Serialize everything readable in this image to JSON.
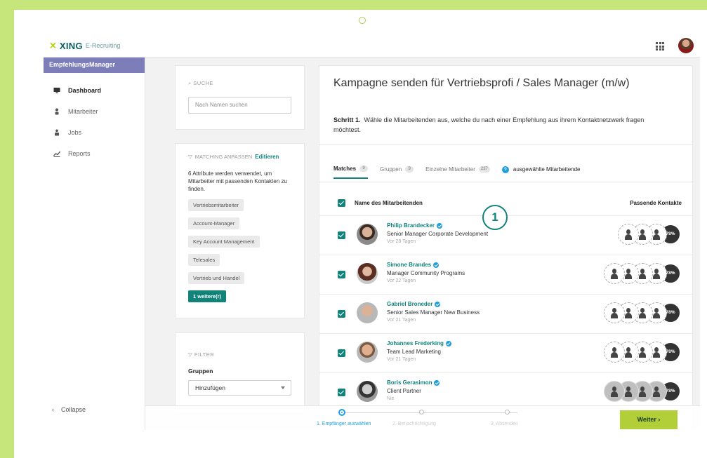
{
  "app": {
    "brand": "XING",
    "brand_sub": "E-Recruiting"
  },
  "sidebar": {
    "header": "EmpfehlungsManager",
    "items": [
      {
        "label": "Dashboard",
        "icon": "monitor-icon",
        "active": true
      },
      {
        "label": "Mitarbeiter",
        "icon": "person-icon",
        "active": false
      },
      {
        "label": "Jobs",
        "icon": "briefcase-person-icon",
        "active": false
      },
      {
        "label": "Reports",
        "icon": "chart-icon",
        "active": false
      }
    ],
    "collapse_label": "Collapse"
  },
  "search": {
    "label": "SUCHE",
    "placeholder": "Nach Namen suchen"
  },
  "matching": {
    "label": "MATCHING ANPASSEN",
    "edit_label": "Editieren",
    "description": "6 Attribute werden verwendet, um Mitarbeiter mit passenden Kontakten zu finden.",
    "tags": [
      "Vertriebsmitarbeiter",
      "Account-Manager",
      "Key Account Management",
      "Telesales",
      "Vertrieb und Handel"
    ],
    "more_label": "1 weitere(r)"
  },
  "filter": {
    "label": "FILTER",
    "group_label": "Gruppen",
    "select_value": "Hinzufügen"
  },
  "main": {
    "title": "Kampagne senden für Vertriebsprofi / Sales Manager (m/w)",
    "step_label": "Schritt 1.",
    "step_text": "Wähle die Mitarbeitenden aus, welche du nach einer Empfehlung aus ihrem Kontaktnetzwerk fragen möchtest.",
    "tabs": [
      {
        "label": "Matches",
        "count": "9",
        "active": true
      },
      {
        "label": "Gruppen",
        "count": "9",
        "active": false
      },
      {
        "label": "Einzelne Mitarbeiter",
        "count": "237",
        "active": false
      }
    ],
    "selected_count": "9",
    "selected_label": "ausgewählte Mitarbeitende",
    "col_name": "Name des Mitarbeitenden",
    "col_contacts": "Passende Kontakte",
    "callout": "1"
  },
  "employees": [
    {
      "name": "Philip Brandecker",
      "role": "Senior Manager Corporate Development",
      "ago": "Vor 28 Tagen",
      "match": "78%",
      "contacts": 3
    },
    {
      "name": "Simone Brandes",
      "role": "Manager Community Programs",
      "ago": "Vor 22 Tagen",
      "match": "78%",
      "contacts": 4
    },
    {
      "name": "Gabriel Broneder",
      "role": "Senior Sales Manager New Business",
      "ago": "Vor 21 Tagen",
      "match": "78%",
      "contacts": 4
    },
    {
      "name": "Johannes Frederking",
      "role": "Team Lead Marketing",
      "ago": "Vor 21 Tagen",
      "match": "78%",
      "contacts": 4
    },
    {
      "name": "Boris Gerasimon",
      "role": "Client Partner",
      "ago": "Nie",
      "match": "78%",
      "contacts": 4
    }
  ],
  "progress": {
    "steps": [
      "1. Empfänger auswählen",
      "2. Benachrichtigung",
      "3. Absenden"
    ]
  },
  "next_button": "Weiter ›",
  "colors": {
    "accent": "#11837b",
    "brand_green": "#b2cf3a",
    "sidebar_header": "#7d7dba",
    "frame_green": "#c6e67c"
  }
}
